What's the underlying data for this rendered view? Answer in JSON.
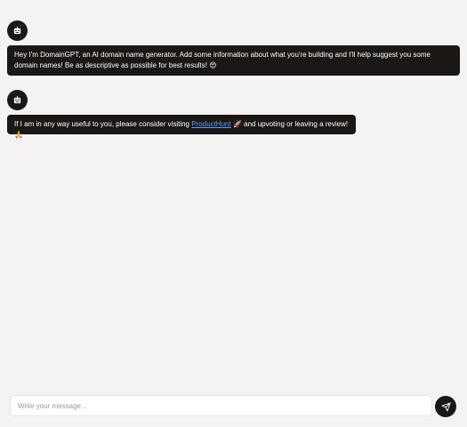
{
  "messages": [
    {
      "sender": "bot",
      "avatar_icon": "robot-icon",
      "text": "Hey I'm DomainGPT, an AI domain name generator. Add some information about what you're building and I'll help suggest you some domain names! Be as descriptive as possible for best results!",
      "emoji": "😍"
    },
    {
      "sender": "bot",
      "avatar_icon": "robot-icon",
      "text_before": "If I am in any way useful to you, please consider visiting",
      "link_text": "ProductHunt",
      "emoji_1": "🚀",
      "text_after": "and upvoting or leaving a review!",
      "emoji_2": "🙏"
    }
  ],
  "composer": {
    "placeholder": "Write your message...",
    "send_icon": "send-icon"
  },
  "colors": {
    "background": "#f4f3f2",
    "bubble": "#1b1715",
    "link": "#5aa0ff"
  }
}
